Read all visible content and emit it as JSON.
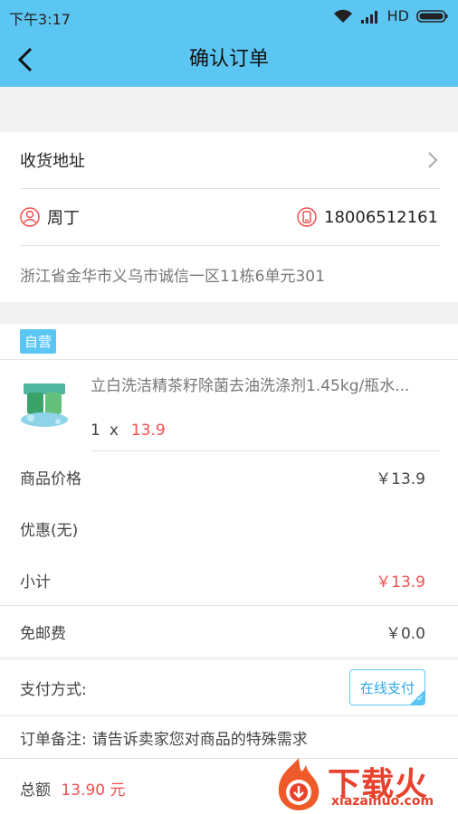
{
  "status": {
    "time": "下午3:17",
    "network": "HD"
  },
  "nav": {
    "title": "确认订单"
  },
  "address": {
    "header": "收货地址",
    "name": "周丁",
    "phone": "18006512161",
    "detail": "浙江省金华市义乌市诚信一区11栋6单元301"
  },
  "shop": {
    "badge": "自营"
  },
  "product": {
    "title": "立白洗洁精茶籽除菌去油洗涤剂1.45kg/瓶水...",
    "qty": "1",
    "times": "x",
    "price": "13.9"
  },
  "summary": {
    "items": [
      {
        "label": "商品价格",
        "value": "￥13.9"
      },
      {
        "label": "优惠(无)",
        "value": ""
      },
      {
        "label": "小计",
        "value": "￥13.9"
      },
      {
        "label": "免邮费",
        "value": "￥0.0"
      }
    ]
  },
  "payment": {
    "label": "支付方式:",
    "method": "在线支付"
  },
  "remark": {
    "label": "订单备注:",
    "placeholder": "请告诉卖家您对商品的特殊需求"
  },
  "footer": {
    "total_label": "总额",
    "total_value": "13.90 元"
  },
  "watermark": {
    "brand": "下载火",
    "url": "xiazaihuo.com"
  },
  "colors": {
    "accent": "#5cc6f3",
    "price": "#f0504e",
    "watermark": "#e8412c"
  }
}
